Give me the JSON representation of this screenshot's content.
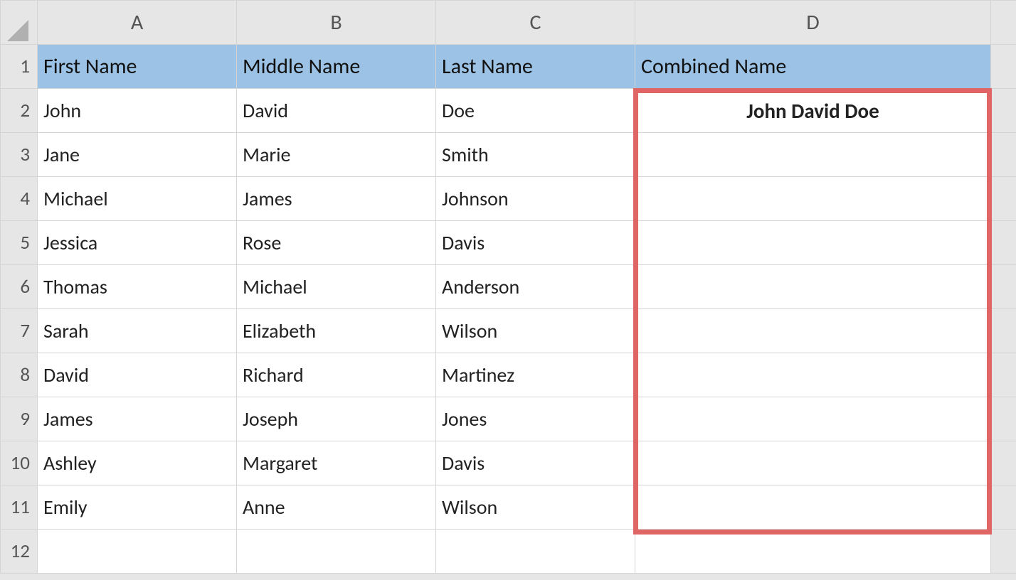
{
  "columns": {
    "A": "A",
    "B": "B",
    "C": "C",
    "D": "D"
  },
  "headers": {
    "A": "First Name",
    "B": "Middle Name",
    "C": "Last Name",
    "D": "Combined Name"
  },
  "rows": [
    {
      "n": "1"
    },
    {
      "n": "2",
      "A": "John",
      "B": "David",
      "C": "Doe",
      "D": "John David Doe"
    },
    {
      "n": "3",
      "A": "Jane",
      "B": "Marie",
      "C": "Smith",
      "D": ""
    },
    {
      "n": "4",
      "A": "Michael",
      "B": "James",
      "C": "Johnson",
      "D": ""
    },
    {
      "n": "5",
      "A": "Jessica",
      "B": "Rose",
      "C": "Davis",
      "D": ""
    },
    {
      "n": "6",
      "A": "Thomas",
      "B": "Michael",
      "C": "Anderson",
      "D": ""
    },
    {
      "n": "7",
      "A": "Sarah",
      "B": "Elizabeth",
      "C": "Wilson",
      "D": ""
    },
    {
      "n": "8",
      "A": "David",
      "B": "Richard",
      "C": "Martinez",
      "D": ""
    },
    {
      "n": "9",
      "A": "James",
      "B": "Joseph",
      "C": "Jones",
      "D": ""
    },
    {
      "n": "10",
      "A": "Ashley",
      "B": "Margaret",
      "C": "Davis",
      "D": ""
    },
    {
      "n": "11",
      "A": "Emily",
      "B": "Anne",
      "C": "Wilson",
      "D": ""
    },
    {
      "n": "12",
      "A": "",
      "B": "",
      "C": "",
      "D": ""
    }
  ],
  "highlight": {
    "colors": {
      "border": "#e06666"
    }
  }
}
